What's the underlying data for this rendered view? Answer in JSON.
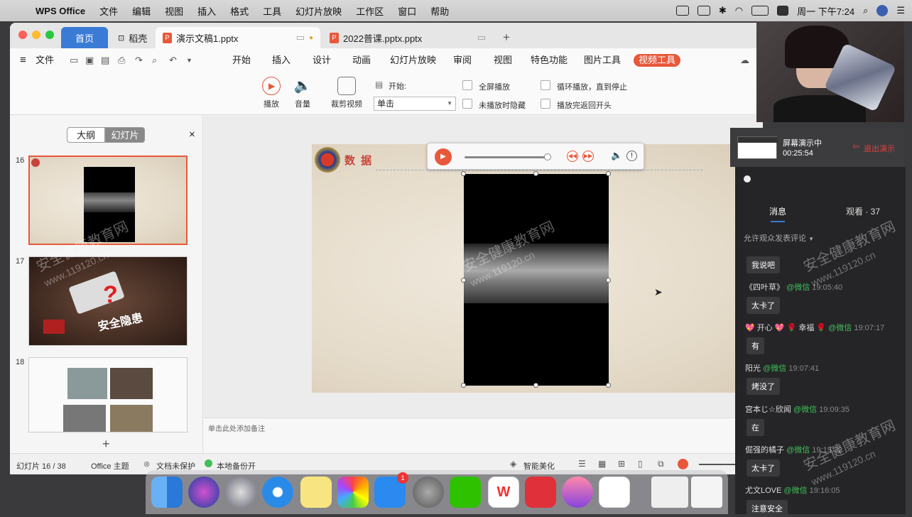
{
  "menubar": {
    "app": "WPS Office",
    "items": [
      "文件",
      "编辑",
      "视图",
      "插入",
      "格式",
      "工具",
      "幻灯片放映",
      "工作区",
      "窗口",
      "帮助"
    ],
    "clock": "周一 下午7:24"
  },
  "tabs": {
    "home": "首页",
    "daoke": "稻壳",
    "doc1": "演示文稿1.pptx",
    "doc2": "2022普课.pptx.pptx",
    "add": "+"
  },
  "toolbar": {
    "file": "文件",
    "menus": [
      "开始",
      "插入",
      "设计",
      "动画",
      "幻灯片放映",
      "审阅",
      "视图",
      "特色功能",
      "图片工具"
    ],
    "active": "视频工具"
  },
  "ribbon": {
    "play": "播放",
    "volume": "音量",
    "trim": "裁剪视频",
    "start_label": "开始:",
    "start_value": "单击",
    "fullscreen": "全屏播放",
    "hide_unplayed": "未播放时隐藏",
    "loop": "循环播放，直到停止",
    "rewind": "播放完返回开头"
  },
  "leftpanel": {
    "outline": "大纲",
    "slides": "幻灯片",
    "close": "×",
    "slide_numbers": [
      "16",
      "17",
      "18"
    ],
    "slide17_text": "安全隐患",
    "add": "+"
  },
  "slide": {
    "title": "数 据"
  },
  "notes": {
    "placeholder": "单击此处添加备注"
  },
  "status": {
    "slide_counter": "幻灯片 16 / 38",
    "theme": "Office 主题",
    "protect": "文档未保护",
    "backup": "本地备份开",
    "beautify": "智能美化"
  },
  "presentation": {
    "status": "屏幕演示中",
    "timer": "00:25:54",
    "exit": "退出演示"
  },
  "chat": {
    "tab_messages": "消息",
    "tab_viewers": "观看 · 37",
    "allow_comments": "允许观众发表评论",
    "messages": [
      {
        "user": "",
        "source": "",
        "time": "",
        "text": "我说吧"
      },
      {
        "user": "《四叶草》",
        "source": "@微信",
        "time": "19:05:40",
        "text": "太卡了"
      },
      {
        "user": "💖 开心 💖 🌹 幸福 🌹",
        "source": "@微信",
        "time": "19:07:17",
        "text": "有"
      },
      {
        "user": "阳光",
        "source": "@微信",
        "time": "19:07:41",
        "text": "烤没了"
      },
      {
        "user": "宫本じ☆欣闻",
        "source": "@微信",
        "time": "19:09:35",
        "text": "在"
      },
      {
        "user": "倔强的橘子",
        "source": "@微信",
        "time": "19:15:32",
        "text": "太卡了"
      },
      {
        "user": "尤文LOVE",
        "source": "@微信",
        "time": "19:16:05",
        "text": "注意安全"
      }
    ]
  },
  "watermark": {
    "line1": "安全健康教育网",
    "line2": "www.119120.cn"
  },
  "colors": {
    "accent": "#e8583a",
    "active_tab": "#3a7bd5",
    "video_tool": "#e8583a",
    "wechat_green": "#3fbf5a"
  }
}
